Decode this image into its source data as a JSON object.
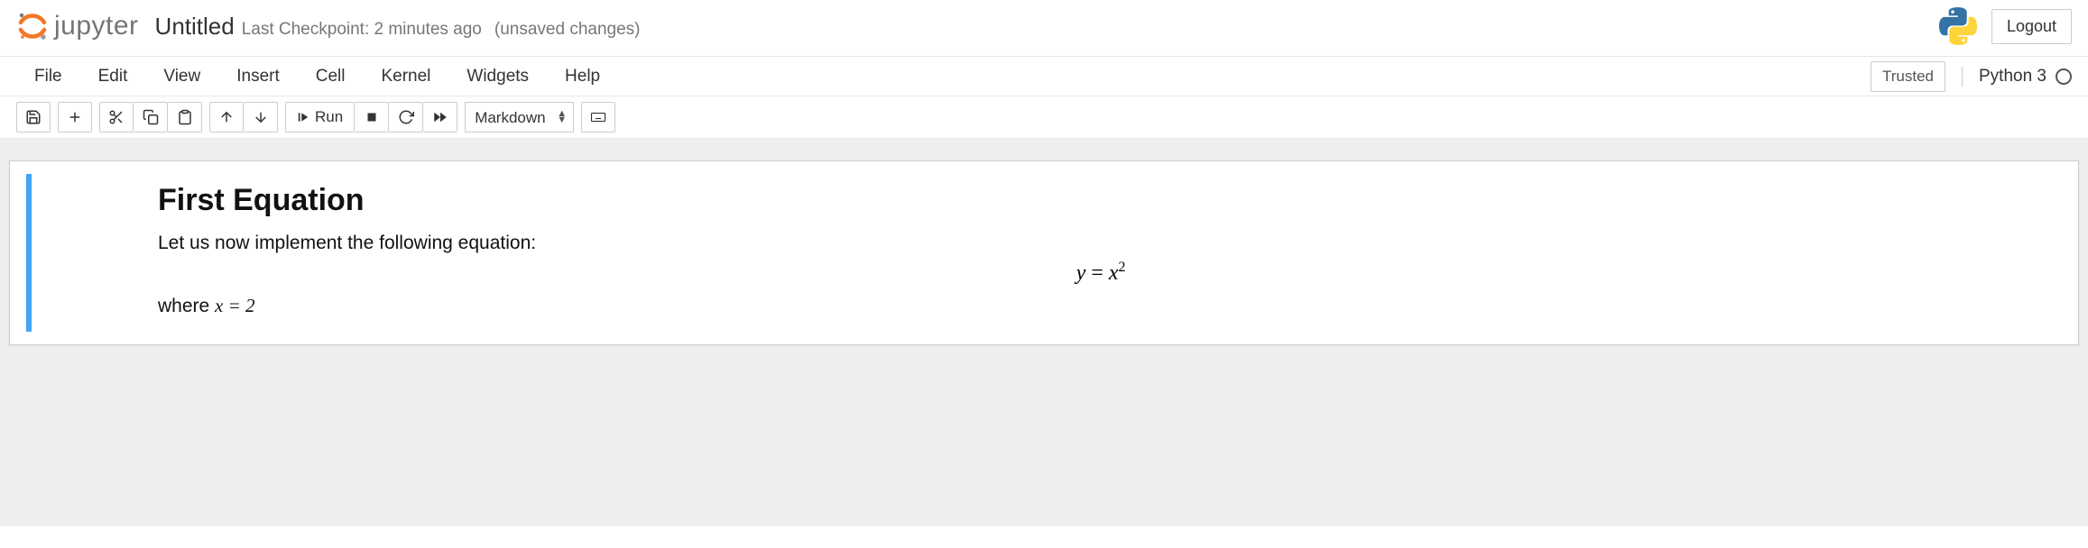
{
  "header": {
    "logo_text": "jupyter",
    "notebook_title": "Untitled",
    "checkpoint": "Last Checkpoint: 2 minutes ago",
    "unsaved": "(unsaved changes)",
    "logout": "Logout"
  },
  "menubar": {
    "items": [
      "File",
      "Edit",
      "View",
      "Insert",
      "Cell",
      "Kernel",
      "Widgets",
      "Help"
    ],
    "trusted": "Trusted",
    "kernel": "Python 3"
  },
  "toolbar": {
    "run_label": "Run",
    "cell_type": "Markdown"
  },
  "cell": {
    "heading": "First Equation",
    "intro": "Let us now implement the following equation:",
    "where_prefix": "where ",
    "where_math": "x = 2",
    "equation_y": "y",
    "equation_eq": " = ",
    "equation_x": "x",
    "equation_sup": "2"
  }
}
